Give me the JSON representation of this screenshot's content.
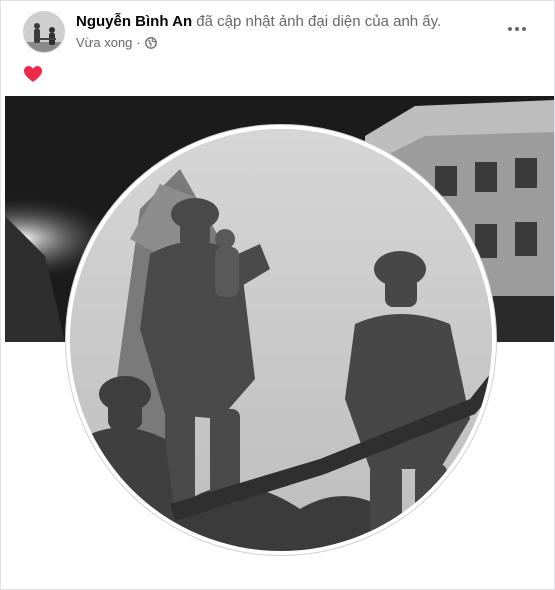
{
  "post": {
    "author_name": "Nguyễn Bình An",
    "action_text": " đã cập nhật ảnh đại diện của anh ấy.",
    "timestamp": "Vừa xong",
    "separator": "·",
    "audience_icon": "globe-icon",
    "reaction_icon": "heart-icon",
    "more_icon": "more-options-icon"
  },
  "colors": {
    "secondary_text": "#65676b",
    "primary_text": "#050505",
    "heart": "#f02849"
  }
}
